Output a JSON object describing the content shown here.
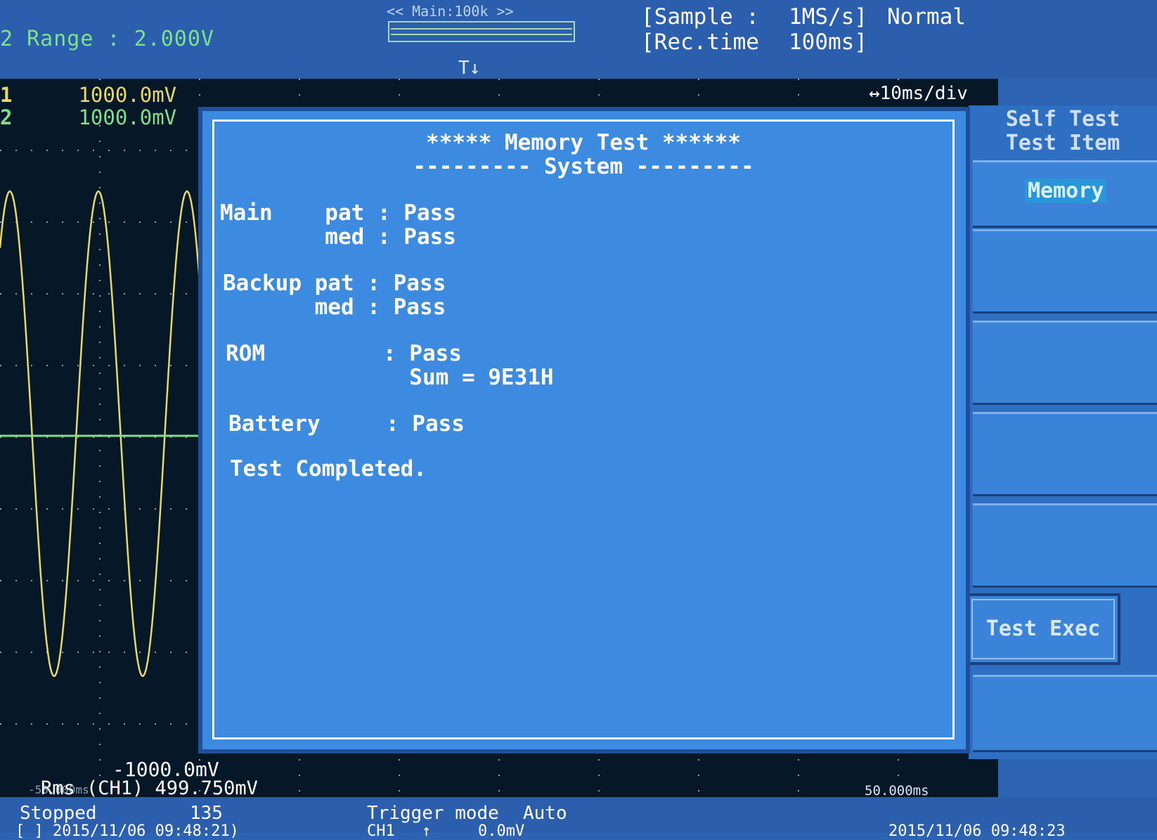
{
  "header": {
    "range_text": "2 Range : 2.000V",
    "main_zoom": "<< Main:100k >>",
    "sample_label": "[Sample :",
    "sample_value": "1MS/s]",
    "sample_mode": "Normal",
    "rec_label": "[Rec.time",
    "rec_value": "100ms]",
    "trigger_marker": "T"
  },
  "waveform": {
    "ch1_label": "1",
    "ch1_scale": "1000.0mV",
    "ch2_label": "2",
    "ch2_scale": "1000.0mV",
    "time_per_div": "↔10ms/div",
    "neg_scale": "-1000.0mV",
    "rms_readout": "Rms (CH1) 499.750mV",
    "start_time": "-50.000ms",
    "end_time": "50.000ms"
  },
  "dialog": {
    "title": "***** Memory Test ******",
    "subtitle": "--------- System ---------",
    "rows": [
      "Main    pat : Pass",
      "        med : Pass",
      "Backup pat : Pass",
      "       med : Pass",
      "ROM         : Pass",
      "              Sum = 9E31H",
      "Battery     : Pass",
      "Test Completed."
    ]
  },
  "menu": {
    "title": "Self Test",
    "subtitle": "Test Item",
    "selected_item": "Memory",
    "exec_button": "Test Exec"
  },
  "status": {
    "state": "Stopped",
    "count": "135",
    "trigger_mode_label": "Trigger mode",
    "trigger_mode_value": "Auto",
    "start_timestamp": "[ ] 2015/11/06 09:48:21)",
    "trigger_channel": "CH1",
    "trigger_level": "0.0mV",
    "end_timestamp": "2015/11/06 09:48:23"
  },
  "colors": {
    "background": "#2d63b3",
    "grid": "#061827",
    "ch1": "#e8d76a",
    "ch2": "#7ee08a",
    "dialog": "#3d8be0"
  }
}
